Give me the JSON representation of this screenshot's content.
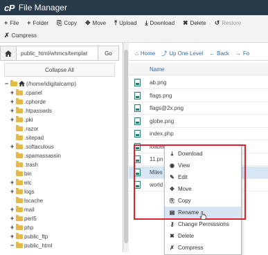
{
  "header": {
    "logo": "cP",
    "title": "File Manager"
  },
  "toolbar": {
    "row1": [
      {
        "icon": "+",
        "label": "File"
      },
      {
        "icon": "+",
        "label": "Folder"
      },
      {
        "icon": "⎘",
        "label": "Copy"
      },
      {
        "icon": "✥",
        "label": "Move"
      },
      {
        "icon": "⤒",
        "label": "Upload"
      },
      {
        "icon": "⤓",
        "label": "Download"
      },
      {
        "icon": "✖",
        "label": "Delete"
      },
      {
        "icon": "↺",
        "label": "Restore"
      }
    ],
    "row2": [
      {
        "icon": "✗",
        "label": "Compress"
      }
    ]
  },
  "left": {
    "path_value": "public_html/whmcs/templat",
    "go_label": "Go",
    "collapse_label": "Collapse All",
    "tree": [
      {
        "toggle": "−",
        "label": "(/home/idigitalcamp)",
        "level": 0,
        "home": true
      },
      {
        "toggle": "+",
        "label": ".cpanel",
        "level": 1
      },
      {
        "toggle": "+",
        "label": ".cphorde",
        "level": 1
      },
      {
        "toggle": "+",
        "label": ".htpasswds",
        "level": 1
      },
      {
        "toggle": "+",
        "label": ".pki",
        "level": 1
      },
      {
        "toggle": "",
        "label": ".razor",
        "level": 1
      },
      {
        "toggle": "",
        "label": ".sitepad",
        "level": 1
      },
      {
        "toggle": "+",
        "label": ".softaculous",
        "level": 1
      },
      {
        "toggle": "",
        "label": ".spamassassin",
        "level": 1
      },
      {
        "toggle": "",
        "label": ".trash",
        "level": 1
      },
      {
        "toggle": "",
        "label": "bin",
        "level": 1
      },
      {
        "toggle": "+",
        "label": "etc",
        "level": 1
      },
      {
        "toggle": "+",
        "label": "logs",
        "level": 1
      },
      {
        "toggle": "",
        "label": "lscache",
        "level": 1
      },
      {
        "toggle": "+",
        "label": "mail",
        "level": 1
      },
      {
        "toggle": "+",
        "label": "perl5",
        "level": 1
      },
      {
        "toggle": "+",
        "label": "php",
        "level": 1
      },
      {
        "toggle": "+",
        "label": "public_ftp",
        "level": 1
      },
      {
        "toggle": "−",
        "label": "public_html",
        "level": 1
      }
    ]
  },
  "right": {
    "nav": [
      {
        "icon": "⌂",
        "label": "Home"
      },
      {
        "icon": "⤴",
        "label": "Up One Level"
      },
      {
        "icon": "←",
        "label": "Back"
      },
      {
        "icon": "→",
        "label": "Fo"
      }
    ],
    "column_name": "Name",
    "files": [
      {
        "name": "ab.png"
      },
      {
        "name": "flags.png"
      },
      {
        "name": "flags@2x.png"
      },
      {
        "name": "globe.png"
      },
      {
        "name": "index.php"
      },
      {
        "name": "loader.gif"
      },
      {
        "name": "11.pn"
      },
      {
        "name": "Miles"
      },
      {
        "name": "world"
      }
    ]
  },
  "context_menu": {
    "items": [
      {
        "icon": "⤓",
        "label": "Download"
      },
      {
        "icon": "◉",
        "label": "View"
      },
      {
        "icon": "✎",
        "label": "Edit"
      },
      {
        "icon": "✥",
        "label": "Move"
      },
      {
        "icon": "⎘",
        "label": "Copy"
      },
      {
        "icon": "▤",
        "label": "Rename"
      },
      {
        "icon": "⚷",
        "label": "Change Permissions"
      },
      {
        "icon": "✖",
        "label": "Delete"
      },
      {
        "icon": "✗",
        "label": "Compress"
      }
    ]
  },
  "colors": {
    "header_bg": "#293a4a",
    "link": "#2a6db0",
    "highlight": "#d9232e",
    "folder": "#e6b84a"
  }
}
